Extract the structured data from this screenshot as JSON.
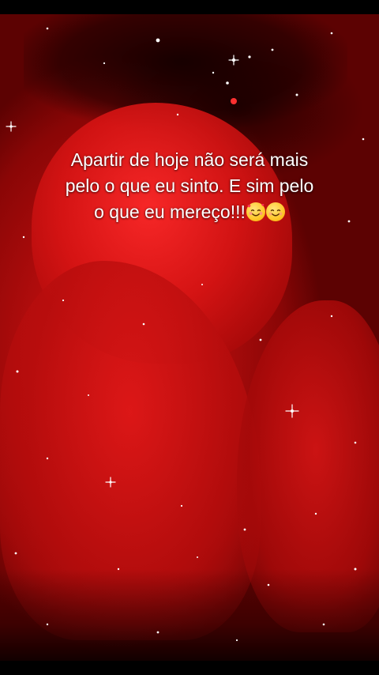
{
  "post": {
    "caption_lines": [
      "Apartir de hoje não será mais",
      "pelo o que eu sinto. E sim pelo",
      "o que eu mereço!!!"
    ],
    "emojis": [
      "smiling-face-with-hearts-icon",
      "smiling-face-icon"
    ]
  },
  "colors": {
    "background": "#000000",
    "scene_red": "#c41010",
    "caption_text": "#ffffff"
  }
}
